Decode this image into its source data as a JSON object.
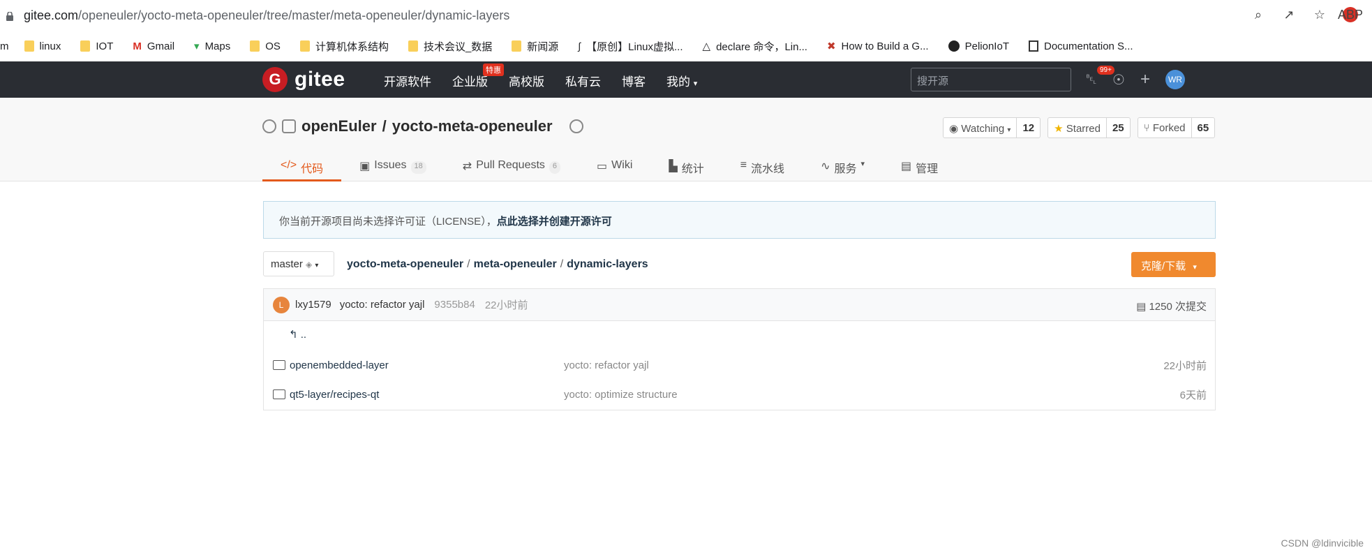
{
  "browser": {
    "url_host": "gitee.com",
    "url_path": "/openeuler/yocto-meta-openeuler/tree/master/meta-openeuler/dynamic-layers",
    "bookmarks": [
      {
        "label": "m"
      },
      {
        "label": "linux"
      },
      {
        "label": "IOT"
      },
      {
        "label": "Gmail"
      },
      {
        "label": "Maps"
      },
      {
        "label": "OS"
      },
      {
        "label": "计算机体系结构"
      },
      {
        "label": "技术会议_数据"
      },
      {
        "label": "新闻源"
      },
      {
        "label": "【原创】Linux虚拟..."
      },
      {
        "label": "declare 命令，Lin..."
      },
      {
        "label": "How to Build a G..."
      },
      {
        "label": "PelionIoT"
      },
      {
        "label": "Documentation S..."
      }
    ]
  },
  "header": {
    "logo_text": "gitee",
    "nav": [
      "开源软件",
      "企业版",
      "高校版",
      "私有云",
      "博客",
      "我的"
    ],
    "hot_badge": "特惠",
    "search_placeholder": "搜开源",
    "notif_badge": "99+",
    "avatar_initials": "WR"
  },
  "repo": {
    "owner": "openEuler",
    "name": "yocto-meta-openeuler",
    "watching_label": "Watching",
    "watching_count": "12",
    "starred_label": "Starred",
    "starred_count": "25",
    "forked_label": "Forked",
    "forked_count": "65",
    "tabs": [
      {
        "label": "代码",
        "count": ""
      },
      {
        "label": "Issues",
        "count": "18"
      },
      {
        "label": "Pull Requests",
        "count": "6"
      },
      {
        "label": "Wiki",
        "count": ""
      },
      {
        "label": "统计",
        "count": ""
      },
      {
        "label": "流水线",
        "count": ""
      },
      {
        "label": "服务",
        "count": ""
      },
      {
        "label": "管理",
        "count": ""
      }
    ]
  },
  "notice": {
    "text": "你当前开源项目尚未选择许可证（LICENSE），",
    "link": "点此选择并创建开源许可"
  },
  "path": {
    "branch": "master",
    "crumbs": [
      "yocto-meta-openeuler",
      "meta-openeuler",
      "dynamic-layers"
    ],
    "clone_label": "克隆/下载"
  },
  "commit": {
    "avatar": "L",
    "author": "lxy1579",
    "message": "yocto: refactor yajl",
    "hash": "9355b84",
    "time": "22小时前",
    "total": "1250 次提交"
  },
  "files": {
    "up": "..",
    "rows": [
      {
        "name": "openembedded-layer",
        "message": "yocto: refactor yajl",
        "time": "22小时前"
      },
      {
        "name": "qt5-layer/recipes-qt",
        "message": "yocto: optimize structure",
        "time": "6天前"
      }
    ]
  },
  "watermark": "CSDN @ldinvicible"
}
